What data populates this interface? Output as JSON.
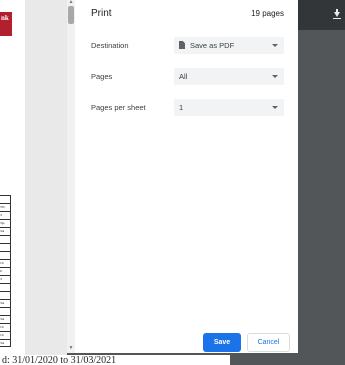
{
  "dialog": {
    "title": "Print",
    "page_count": "19 pages",
    "destination": {
      "label": "Destination",
      "value": "Save as PDF"
    },
    "pages": {
      "label": "Pages",
      "value": "All"
    },
    "pages_per_sheet": {
      "label": "Pages per sheet",
      "value": "1"
    },
    "save_label": "Save",
    "cancel_label": "Cancel"
  },
  "preview": {
    "logo_text": "nk",
    "logo_sub": "nk",
    "table_rows": [
      "",
      "TN",
      "3",
      "3)a",
      "3A",
      "",
      "",
      "",
      "10",
      "0",
      "3",
      "",
      "",
      "3A",
      "",
      "3A",
      "10",
      "10",
      "3A"
    ],
    "footer_text": "d: 31/01/2020 to 31/03/2021"
  },
  "colors": {
    "accent": "#1a73e8",
    "brand": "#b21f2d"
  }
}
